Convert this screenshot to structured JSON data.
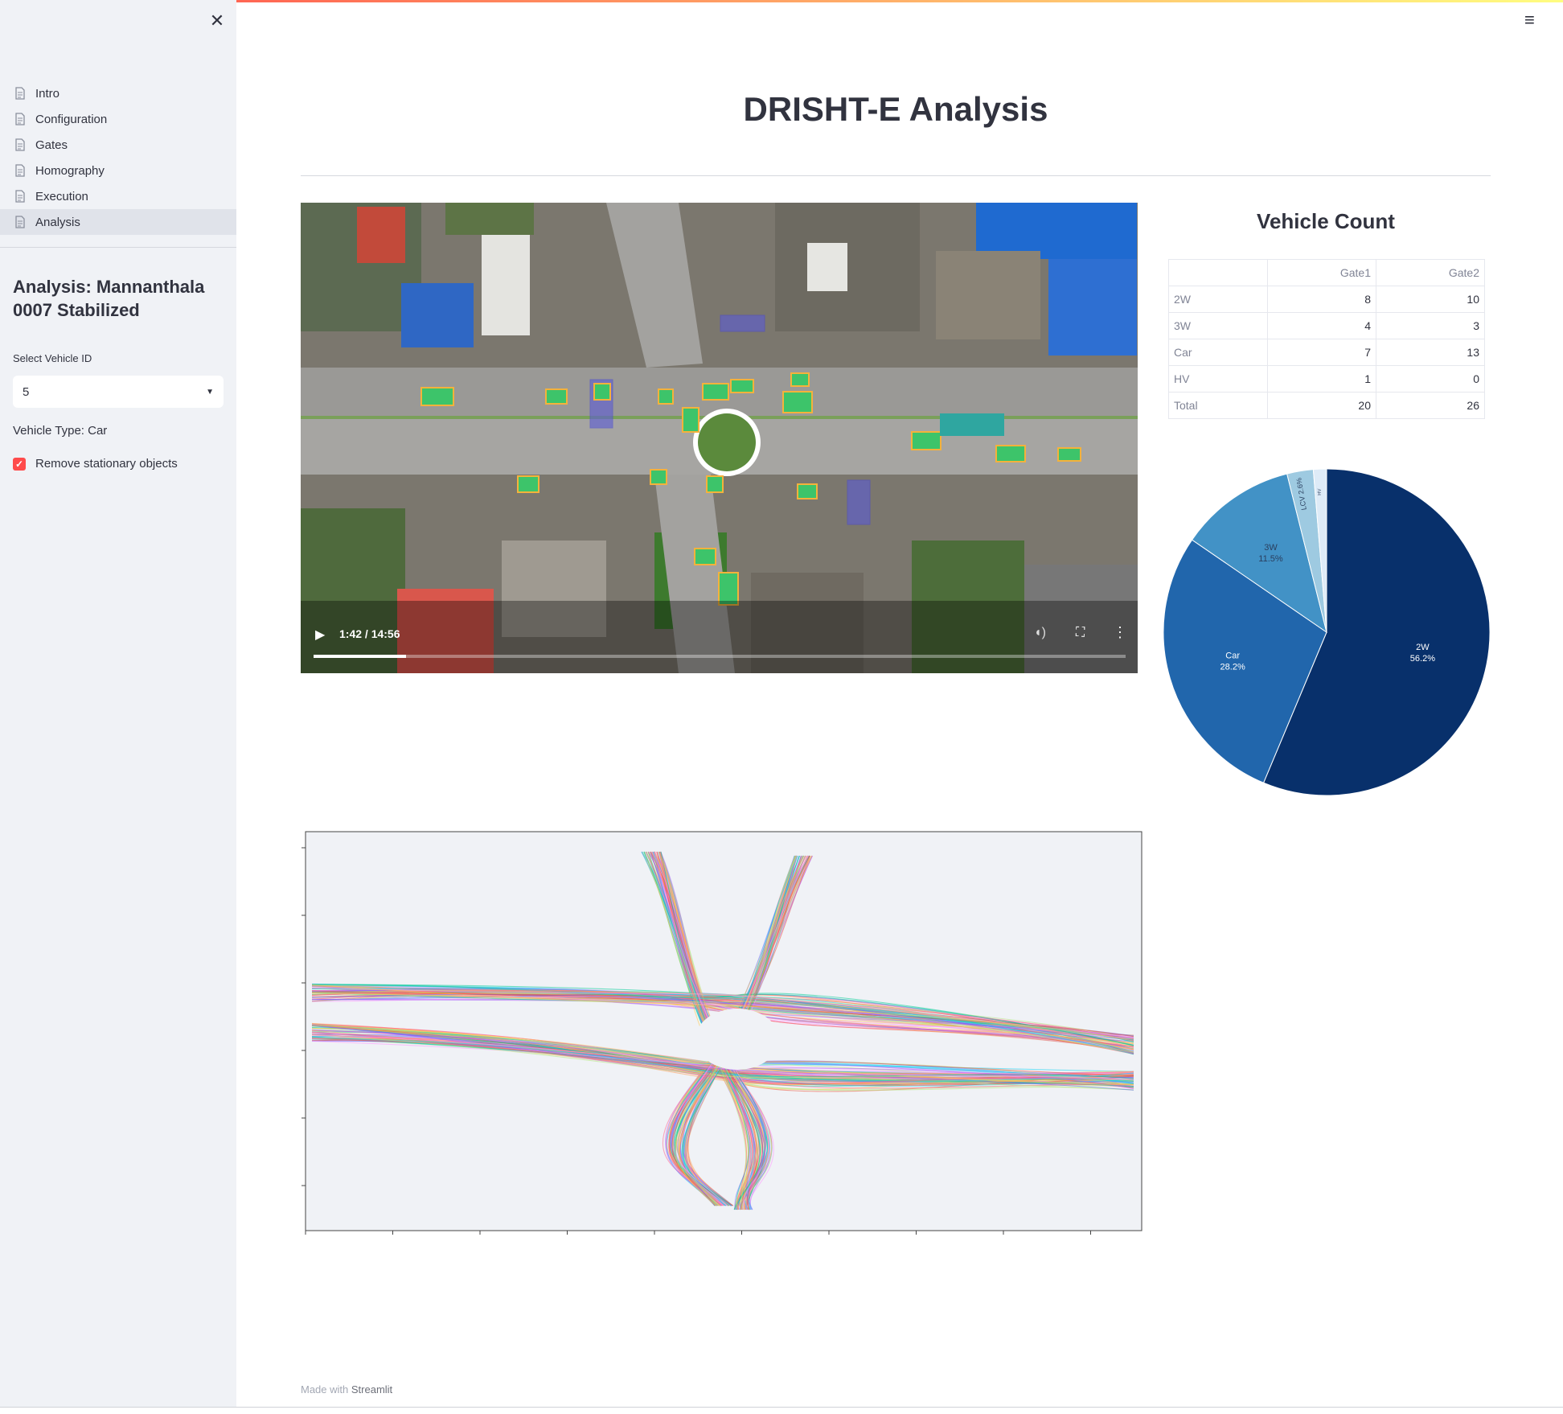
{
  "sidebar": {
    "nav": [
      {
        "label": "Intro",
        "active": false
      },
      {
        "label": "Configuration",
        "active": false
      },
      {
        "label": "Gates",
        "active": false
      },
      {
        "label": "Homography",
        "active": false
      },
      {
        "label": "Execution",
        "active": false
      },
      {
        "label": "Analysis",
        "active": true
      }
    ],
    "title": "Analysis: Mannanthala 0007 Stabilized",
    "select_label": "Select Vehicle ID",
    "select_value": "5",
    "vehicle_type": "Vehicle Type: Car",
    "remove_stationary": {
      "label": "Remove stationary objects",
      "checked": true
    }
  },
  "main": {
    "title": "DRISHT-E Analysis",
    "video": {
      "time": "1:42 / 14:56",
      "progress": 0.114
    },
    "vehicle_count": {
      "title": "Vehicle Count",
      "columns": [
        "Gate1",
        "Gate2"
      ],
      "rows": [
        {
          "label": "2W",
          "values": [
            "8",
            "10"
          ]
        },
        {
          "label": "3W",
          "values": [
            "4",
            "3"
          ]
        },
        {
          "label": "Car",
          "values": [
            "7",
            "13"
          ]
        },
        {
          "label": "HV",
          "values": [
            "1",
            "0"
          ]
        },
        {
          "label": "Total",
          "values": [
            "20",
            "26"
          ]
        }
      ]
    },
    "footer": {
      "prefix": "Made with",
      "brand": "Streamlit"
    }
  },
  "chart_data": [
    {
      "type": "pie",
      "slices": [
        {
          "label": "2W",
          "value": 56.2,
          "text": "56.2%",
          "color": "#08306b"
        },
        {
          "label": "Car",
          "value": 28.2,
          "text": "28.2%",
          "color": "#2166ac"
        },
        {
          "label": "3W",
          "value": 11.5,
          "text": "11.5%",
          "color": "#4292c6"
        },
        {
          "label": "LCV",
          "value": 2.6,
          "text": "2.6%",
          "color": "#9ecae1"
        },
        {
          "label": "HV",
          "value": 1.3,
          "text": "",
          "color": "#deebf7"
        }
      ]
    },
    {
      "type": "scatter",
      "grid": false
    }
  ],
  "colors": {
    "accent": "#ff4b4b",
    "sidebar_bg": "#f0f2f6",
    "plot_bg": "#f0f2f6"
  }
}
